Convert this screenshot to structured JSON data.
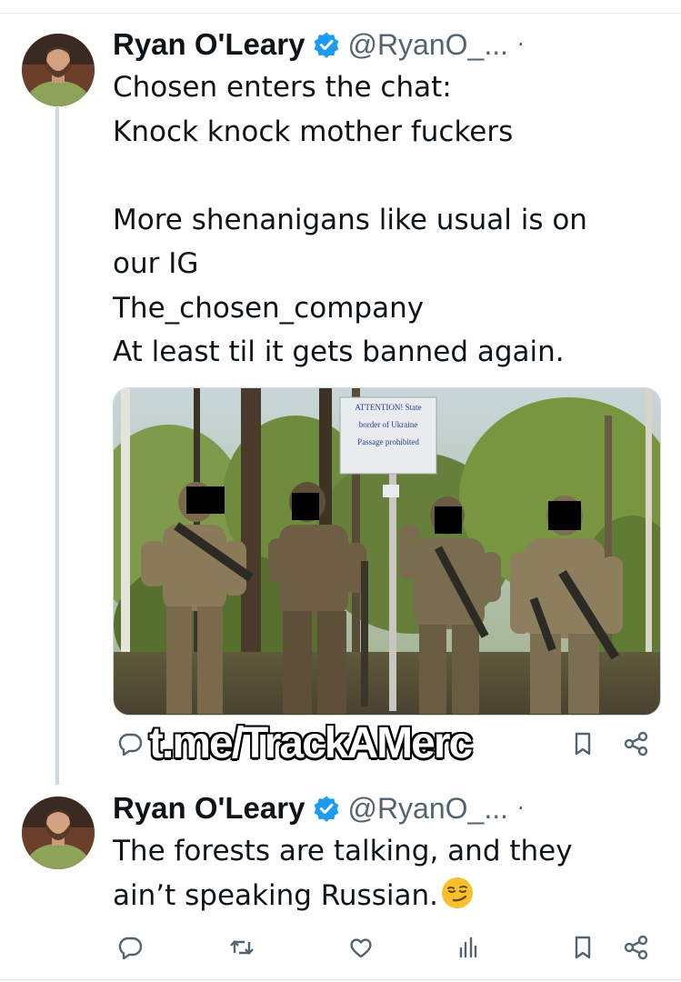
{
  "colors": {
    "text": "#0f1419",
    "muted": "#536471",
    "verified": "#1d9bf0",
    "thread_line": "#cfd9de"
  },
  "tweets": [
    {
      "author_name": "Ryan O'Leary",
      "handle": "@RyanO_...",
      "separator": "·",
      "lines": [
        "Chosen enters the chat:",
        "Knock knock mother fuckers",
        "",
        "More shenanigans like usual is on",
        "our IG",
        "The_chosen_company",
        "At least til it gets banned again."
      ],
      "media": {
        "sign_lines": [
          "ATTENTION! State",
          "border of Ukraine",
          "Passage prohibited"
        ]
      },
      "actions": [
        "reply-icon",
        "bookmark-icon",
        "share-icon"
      ]
    },
    {
      "author_name": "Ryan O'Leary",
      "handle": "@RyanO_...",
      "separator": "·",
      "lines": [
        "The forests are talking, and they",
        "ain’t speaking Russian."
      ],
      "emoji": "smirking-face-icon",
      "actions": [
        "reply-icon",
        "retweet-icon",
        "like-icon",
        "views-icon",
        "bookmark-icon",
        "share-icon"
      ]
    }
  ],
  "watermark": "t.me/TrackAMerc"
}
